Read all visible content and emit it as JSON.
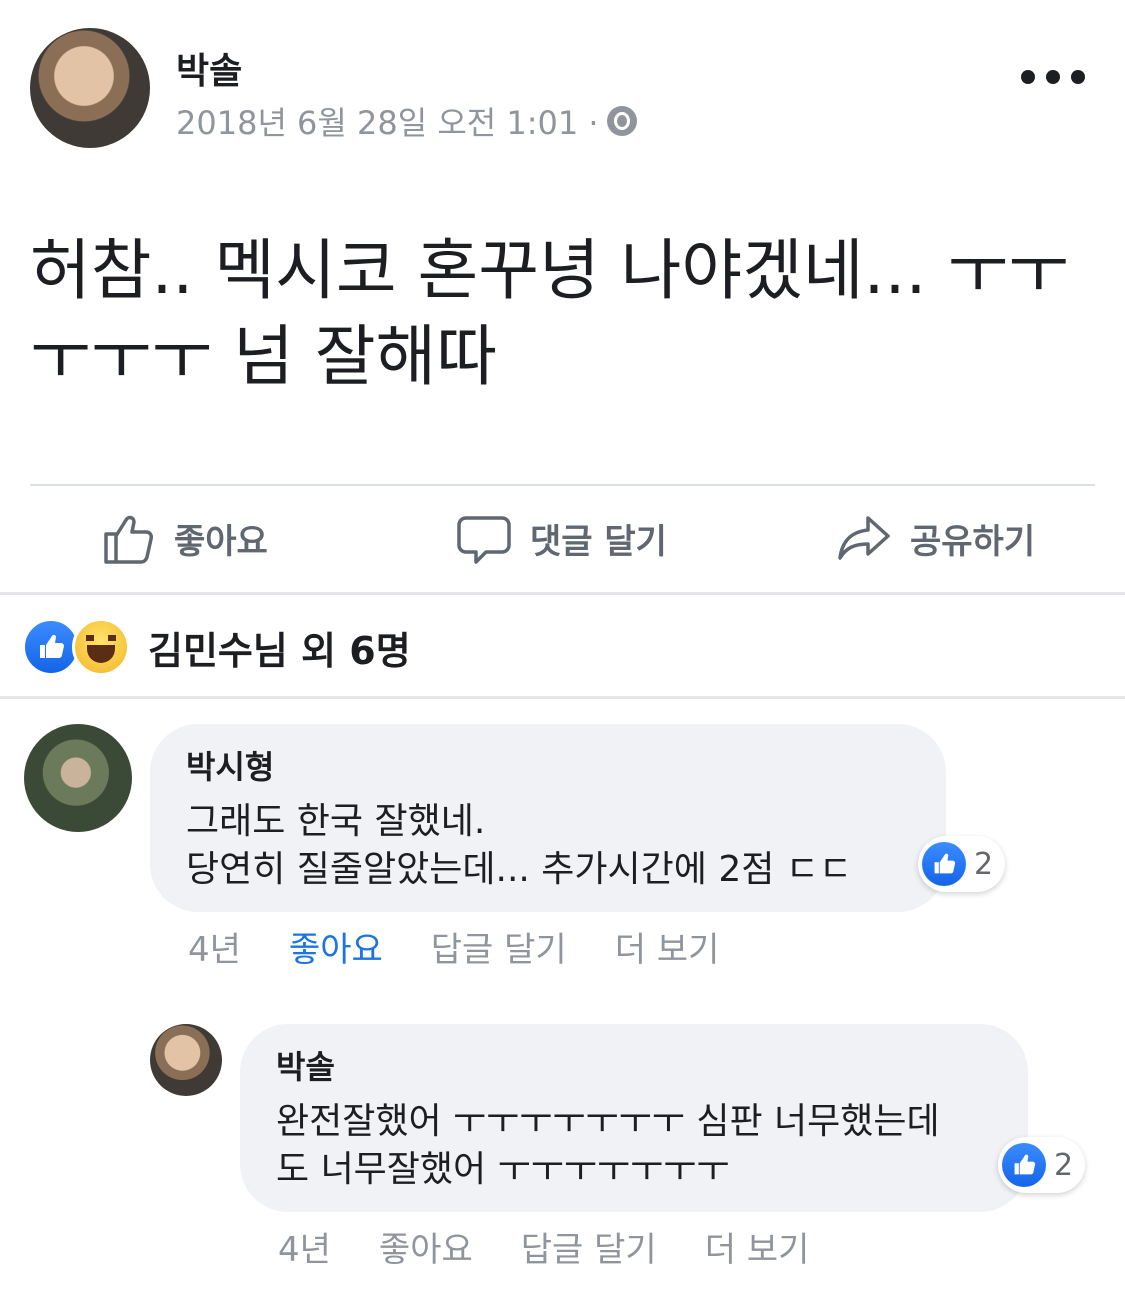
{
  "post": {
    "author": "박솔",
    "timestamp": "2018년 6월 28일 오전 1:01 ·",
    "privacy_icon": "globe-icon",
    "text": "허참.. 멕시코 혼꾸녕 나야겠네... ㅜㅜㅜㅜㅜ 넘 잘해따"
  },
  "actions": {
    "like": "좋아요",
    "comment": "댓글 달기",
    "share": "공유하기"
  },
  "reactions": {
    "summary": "김민수님 외 6명",
    "types": [
      "like",
      "haha"
    ]
  },
  "comments": [
    {
      "name": "박시형",
      "line1": "그래도 한국 잘했네.",
      "line2": "당연히 질줄알았는데... 추가시간에 2점 ㄷㄷ",
      "likes": "2",
      "time": "4년",
      "like_label": "좋아요",
      "like_active": true,
      "reply_label": "답글 달기",
      "more_label": "더 보기"
    },
    {
      "name": "박솔",
      "line1": "완전잘했어 ㅜㅜㅜㅜㅜㅜㅜ 심판 너무했는데",
      "line2": "도 너무잘했어 ㅜㅜㅜㅜㅜㅜㅜ",
      "likes": "2",
      "time": "4년",
      "like_label": "좋아요",
      "like_active": false,
      "reply_label": "답글 달기",
      "more_label": "더 보기"
    }
  ],
  "colors": {
    "accent": "#1b74e4",
    "muted": "#90949c",
    "bubble": "#f0f2f5"
  }
}
